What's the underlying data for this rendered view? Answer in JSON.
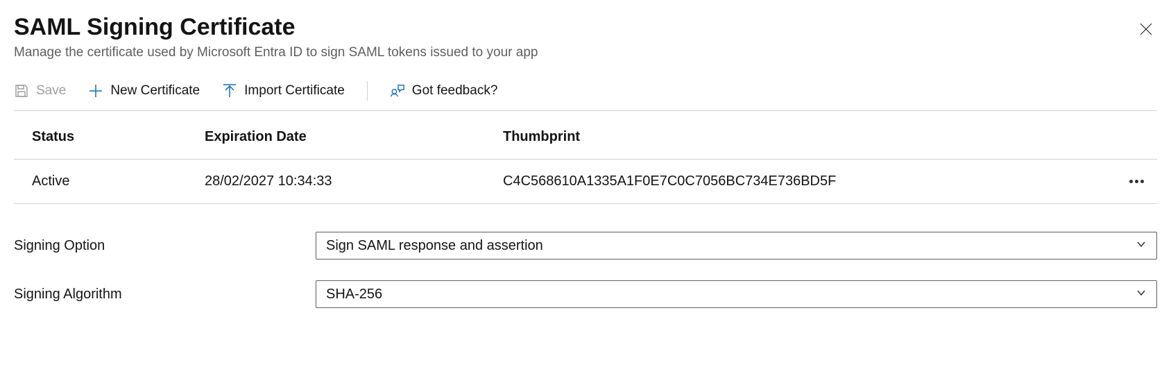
{
  "header": {
    "title": "SAML Signing Certificate",
    "subtitle": "Manage the certificate used by Microsoft Entra ID to sign SAML tokens issued to your app"
  },
  "toolbar": {
    "save_label": "Save",
    "new_cert_label": "New Certificate",
    "import_cert_label": "Import Certificate",
    "feedback_label": "Got feedback?"
  },
  "table": {
    "headers": {
      "status": "Status",
      "expiration": "Expiration Date",
      "thumbprint": "Thumbprint"
    },
    "rows": [
      {
        "status": "Active",
        "expiration": "28/02/2027 10:34:33",
        "thumbprint": "C4C568610A1335A1F0E7C0C7056BC734E736BD5F"
      }
    ]
  },
  "form": {
    "signing_option_label": "Signing Option",
    "signing_option_value": "Sign SAML response and assertion",
    "signing_algorithm_label": "Signing Algorithm",
    "signing_algorithm_value": "SHA-256"
  }
}
